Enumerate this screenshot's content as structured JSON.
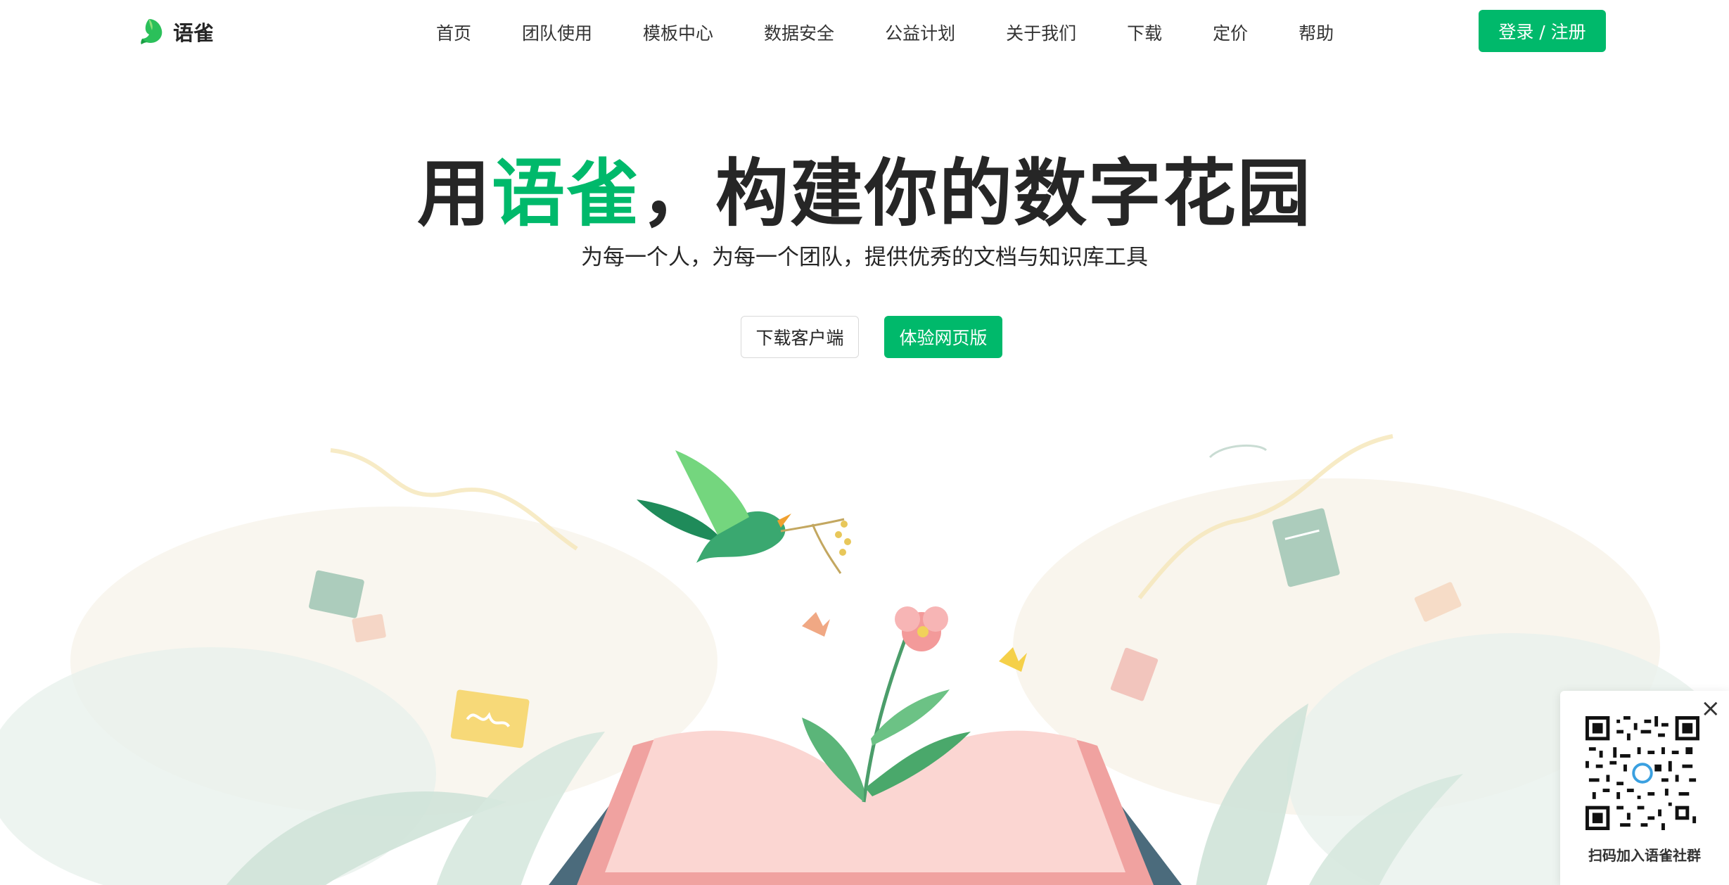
{
  "header": {
    "logo_text": "语雀",
    "nav": [
      {
        "label": "首页"
      },
      {
        "label": "团队使用"
      },
      {
        "label": "模板中心"
      },
      {
        "label": "数据安全"
      },
      {
        "label": "公益计划"
      },
      {
        "label": "关于我们"
      },
      {
        "label": "下载"
      },
      {
        "label": "定价"
      },
      {
        "label": "帮助"
      }
    ],
    "login_label": "登录 / 注册"
  },
  "hero": {
    "title_prefix": "用",
    "title_accent": "语雀",
    "title_suffix": "，构建你的数字花园",
    "subtitle": "为每一个人，为每一个团队，提供优秀的文档与知识库工具",
    "download_label": "下载客户端",
    "web_label": "体验网页版"
  },
  "qr": {
    "caption": "扫码加入语雀社群",
    "close_symbol": "×"
  },
  "colors": {
    "brand_green": "#00b96b",
    "text_dark": "#262626"
  }
}
